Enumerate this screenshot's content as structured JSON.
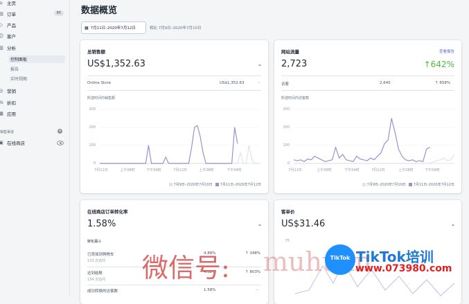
{
  "sidebar": {
    "items": [
      {
        "label": "主页",
        "icon": "home-icon",
        "glyph": "⌂"
      },
      {
        "label": "订单",
        "icon": "orders-icon",
        "glyph": "▤",
        "badge": "65"
      },
      {
        "label": "产品",
        "icon": "tag-icon",
        "glyph": "◇"
      },
      {
        "label": "客户",
        "icon": "customer-icon",
        "glyph": "☺"
      },
      {
        "label": "分析",
        "icon": "analytics-icon",
        "glyph": "▥"
      }
    ],
    "analytics_sub": [
      "控制面板",
      "报告",
      "实时视图"
    ],
    "items2": [
      {
        "label": "营销",
        "icon": "marketing-icon",
        "glyph": "◎"
      },
      {
        "label": "折扣",
        "icon": "discount-icon",
        "glyph": "%"
      },
      {
        "label": "应用",
        "icon": "apps-icon",
        "glyph": "▦"
      }
    ],
    "channels_label": "销售渠道",
    "online_store": "在线商店"
  },
  "page": {
    "title": "数据概览",
    "date_range": "7月11日–2020年7月12日",
    "compare": "相比 7月9日–2020年7月10日"
  },
  "cards": {
    "sales": {
      "title": "总销售额",
      "value": "US$1,352.63",
      "dash": "-",
      "row_label": "Online Store",
      "row_value": "US$1,352.63",
      "row_dash": "-",
      "chart_label": "所选时间内销售额"
    },
    "traffic": {
      "title": "网站流量",
      "link": "查看报告",
      "value": "2,723",
      "change": "↑642%",
      "row_label": "访客",
      "row_value": "2,645",
      "row_change": "↑ 658%",
      "chart_label": "所选时间内访客数"
    },
    "conversion": {
      "title": "在线商店订单转化率",
      "value": "1.58%",
      "dash": "-",
      "funnel_label": "转化漏斗",
      "rows": [
        {
          "label": "已添加到购物车",
          "sub": "133 次访问",
          "pct": "4.88%",
          "change": "↑ 348%"
        },
        {
          "label": "达到结账",
          "sub": "134 次访问",
          "pct": "4.92%",
          "change": "↑ 803%"
        },
        {
          "label": "成功转换的访客数",
          "sub": "",
          "pct": "1.58%",
          "change": "-"
        }
      ]
    },
    "aov": {
      "title": "客单价",
      "value": "US$31.46",
      "dash": "-",
      "ytick": "75"
    }
  },
  "watermark": {
    "wechat": "微信号:",
    "tiktok": "TikTok培训",
    "url": "www.073980.com",
    "logo_text": "TikTok"
  },
  "colors": {
    "current": "#9c8fd1",
    "previous": "#dfe3e8",
    "accent": "#5c6ac4",
    "positive": "#50b83c"
  },
  "chart_data": [
    {
      "type": "line",
      "title": "所选时间内销售额",
      "yticks": [
        "0",
        "100",
        "200",
        "300"
      ],
      "ylim": [
        0,
        300
      ],
      "xticks": [
        "7月11日",
        "上午08时",
        "下午04时",
        "7月12日",
        "上午08时",
        "下午04时"
      ],
      "series": [
        {
          "name": "7月11日–2020年7月12日",
          "color": "#9c8fd1",
          "values": [
            0,
            0,
            0,
            0,
            0,
            0,
            0,
            0,
            0,
            0,
            0,
            0,
            0,
            0,
            0,
            0,
            0,
            100,
            0,
            0,
            0,
            0,
            0,
            35,
            0,
            0,
            0,
            0,
            0,
            0,
            0,
            0,
            90,
            200,
            210,
            150,
            60,
            0,
            0,
            0,
            0,
            0,
            0,
            0,
            0,
            0,
            0,
            200,
            110
          ]
        },
        {
          "name": "7月9日–2020年7月10日",
          "color": "#dfe3e8",
          "values": [
            0,
            0,
            0,
            0,
            0,
            0,
            0,
            0,
            0,
            0,
            0,
            0,
            0,
            0,
            0,
            0,
            0,
            0,
            0,
            0,
            0,
            0,
            0,
            0,
            0,
            0,
            0,
            0,
            0,
            0,
            0,
            0,
            0,
            0,
            0,
            0,
            0,
            0,
            0,
            0,
            0,
            0,
            0,
            0,
            0,
            0,
            0,
            0,
            0,
            60,
            0,
            0,
            100,
            20,
            0,
            0,
            0
          ]
        }
      ],
      "legend": [
        "7月9日–2020年7月10日",
        "7月11日–2020年7月12日"
      ]
    },
    {
      "type": "line",
      "title": "所选时间内访客数",
      "yticks": [
        "0",
        "100",
        "200",
        "300"
      ],
      "ylim": [
        0,
        300
      ],
      "xticks": [
        "7月11日",
        "上午08时",
        "下午04时",
        "7月12日",
        "上午08时",
        "下午04时"
      ],
      "series": [
        {
          "name": "7月11日–2020年7月12日",
          "color": "#9c8fd1",
          "values": [
            20,
            15,
            20,
            10,
            25,
            20,
            40,
            30,
            20,
            10,
            15,
            20,
            90,
            30,
            50,
            20,
            15,
            10,
            40,
            25,
            20,
            15,
            30,
            20,
            40,
            60,
            110,
            130,
            250,
            170,
            80,
            40,
            20,
            15,
            20,
            10,
            15,
            10,
            80,
            90
          ]
        },
        {
          "name": "7月9日–2020年7月10日",
          "color": "#dfe3e8",
          "values": [
            0,
            0,
            0,
            0,
            0,
            0,
            0,
            0,
            0,
            0,
            0,
            0,
            0,
            0,
            0,
            0,
            0,
            0,
            0,
            0,
            0,
            0,
            0,
            0,
            0,
            0,
            0,
            0,
            0,
            0,
            0,
            0,
            0,
            0,
            0,
            0,
            0,
            0,
            0,
            0,
            10,
            15,
            20,
            30,
            15,
            20,
            50
          ]
        }
      ],
      "legend": [
        "7月9日–2020年7月10日",
        "7月11日–2020年7月12日"
      ]
    },
    {
      "type": "line",
      "title": "",
      "yticks": [
        "75"
      ],
      "series": []
    }
  ]
}
